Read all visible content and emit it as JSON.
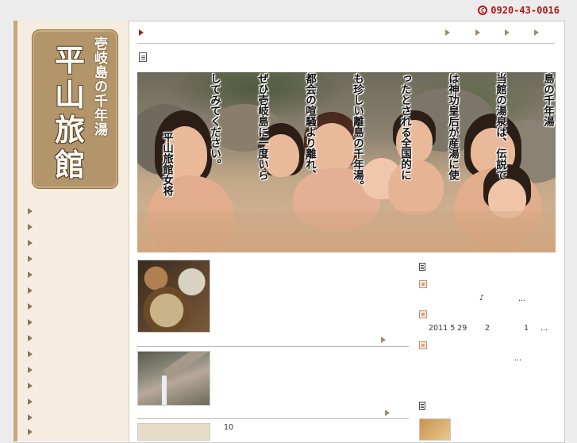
{
  "header": {
    "phone": "0920-43-0016",
    "phone_icon_glyph": "C"
  },
  "logo": {
    "tagline": "壱岐島の千年湯",
    "name": "平山旅館"
  },
  "hero": {
    "lines": [
      "島の千年湯",
      "当館の湯泉は、伝説で",
      "は神功皇后が産湯に使",
      "ったとされる全国的に",
      "も珍しい離島の千年湯。",
      "都会の喧騒より離れ、",
      "ぜひ壱岐島に一度いら",
      "してみてください。",
      "平山旅館女将"
    ]
  },
  "news": {
    "item1": {
      "symbol": "♪",
      "ellipsis": "..."
    },
    "item2": {
      "date": "2011 5 29",
      "num_a": "2",
      "num_b": "1",
      "ellipsis": "..."
    },
    "item3": {
      "ellipsis": "..."
    }
  },
  "lower": {
    "number": "10"
  },
  "colors": {
    "accent": "#9a2a12",
    "sidebar_bg": "#f6ecdf",
    "logo_bg": "#b2956a",
    "phone": "#b01818"
  },
  "icons": [
    "phone-icon",
    "document-icon",
    "list-icon",
    "square-bullet-icon",
    "arrow-right-icon"
  ]
}
